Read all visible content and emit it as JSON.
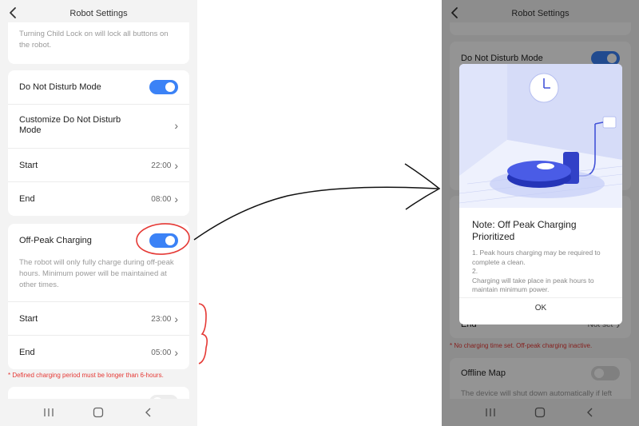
{
  "left_screen": {
    "header": {
      "back_icon": "back-arrow-icon",
      "title": "Robot Settings"
    },
    "child_lock_desc": "Turning Child Lock on will lock all buttons on the robot.",
    "dnd": {
      "label": "Do Not Disturb Mode",
      "enabled": true,
      "customize_label": "Customize Do Not Disturb Mode",
      "start_label": "Start",
      "start_value": "22:00",
      "end_label": "End",
      "end_value": "08:00"
    },
    "off_peak": {
      "label": "Off-Peak Charging",
      "enabled": true,
      "description": "The robot will only fully charge during off-peak hours. Minimum power will be maintained at other times.",
      "start_label": "Start",
      "start_value": "23:00",
      "end_label": "End",
      "end_value": "05:00",
      "warning": "* Defined charging period must be longer than 6-hours."
    },
    "navbar": {
      "recents_icon": "recents-icon",
      "home_icon": "home-icon",
      "back_icon": "back-icon"
    }
  },
  "right_screen": {
    "header": {
      "back_icon": "back-arrow-icon",
      "title": "Robot Settings"
    },
    "dnd_label": "Do Not Disturb Mode",
    "end_label": "End",
    "end_value": "Not set",
    "warning": "* No charging time set. Off-peak charging inactive.",
    "offline_map": {
      "label": "Offline Map",
      "enabled": false,
      "description": "The device will shut down automatically if left"
    },
    "modal": {
      "illustration": "robot-vacuum-charging-illustration",
      "title": "Note: Off Peak Charging Prioritized",
      "line1": "1. Peak hours charging may be required to complete a clean.",
      "line2a": "2.",
      "line2b": "Charging will take place in peak hours to maintain minimum power.",
      "ok_label": "OK"
    },
    "navbar": {
      "recents_icon": "recents-icon",
      "home_icon": "home-icon",
      "back_icon": "back-icon"
    }
  },
  "colors": {
    "accent": "#3b82f6",
    "annotation": "#e53935",
    "warning": "#e53935",
    "background": "#f3f3f3"
  }
}
